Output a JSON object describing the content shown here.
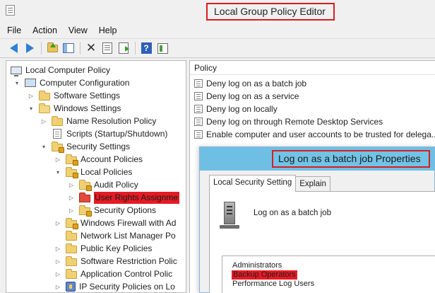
{
  "window": {
    "title": "Local Group Policy Editor"
  },
  "menu": [
    "File",
    "Action",
    "View",
    "Help"
  ],
  "tree": {
    "items": [
      {
        "label": "Local Computer Policy",
        "icon": "computer-icon",
        "expand": "",
        "depth": 0
      },
      {
        "label": "Computer Configuration",
        "icon": "computer-config-icon",
        "expand": "▾",
        "depth": 1
      },
      {
        "label": "Software Settings",
        "icon": "folder-icon",
        "expand": "▷",
        "depth": 2
      },
      {
        "label": "Windows Settings",
        "icon": "folder-icon",
        "expand": "▾",
        "depth": 2
      },
      {
        "label": "Name Resolution Policy",
        "icon": "folder-icon",
        "expand": "▷",
        "depth": 3
      },
      {
        "label": "Scripts (Startup/Shutdown)",
        "icon": "script-icon",
        "expand": "",
        "depth": 3
      },
      {
        "label": "Security Settings",
        "icon": "security-icon",
        "expand": "▾",
        "depth": 3
      },
      {
        "label": "Account Policies",
        "icon": "locked-folder-icon",
        "expand": "▷",
        "depth": 4
      },
      {
        "label": "Local Policies",
        "icon": "locked-folder-icon",
        "expand": "▾",
        "depth": 4
      },
      {
        "label": "Audit Policy",
        "icon": "locked-folder-icon",
        "expand": "▷",
        "depth": 5
      },
      {
        "label": "User Rights Assignme",
        "icon": "red-folder-icon",
        "expand": "▷",
        "depth": 5,
        "selected": true
      },
      {
        "label": "Security Options",
        "icon": "locked-folder-icon",
        "expand": "▷",
        "depth": 5
      },
      {
        "label": "Windows Firewall with Ad",
        "icon": "locked-folder-icon",
        "expand": "▷",
        "depth": 4
      },
      {
        "label": "Network List Manager Po",
        "icon": "folder-icon",
        "expand": "",
        "depth": 4
      },
      {
        "label": "Public Key Policies",
        "icon": "folder-icon",
        "expand": "▷",
        "depth": 4
      },
      {
        "label": "Software Restriction Polic",
        "icon": "folder-icon",
        "expand": "▷",
        "depth": 4
      },
      {
        "label": "Application Control Polic",
        "icon": "folder-icon",
        "expand": "▷",
        "depth": 4
      },
      {
        "label": "IP Security Policies on Lo",
        "icon": "ipsec-icon",
        "expand": "▷",
        "depth": 4
      }
    ]
  },
  "policy_list": {
    "header": "Policy",
    "rows": [
      "Deny log on as a batch job",
      "Deny log on as a service",
      "Deny log on locally",
      "Deny log on through Remote Desktop Services",
      "Enable computer and user accounts to be trusted for delega..."
    ]
  },
  "dialog": {
    "title": "Log on as a batch job Properties",
    "tabs": [
      {
        "label": "Local Security Setting",
        "active": true
      },
      {
        "label": "Explain",
        "active": false
      }
    ],
    "setting_title": "Log on as a batch job",
    "accounts": [
      {
        "name": "Administrators",
        "selected": false
      },
      {
        "name": "Backup Operators",
        "selected": true
      },
      {
        "name": "Performance Log Users",
        "selected": false
      }
    ]
  },
  "colors": {
    "highlight": "#e51b24",
    "dialog_title_bar": "#6fbfe4",
    "title_outline": "#d81e1e"
  }
}
